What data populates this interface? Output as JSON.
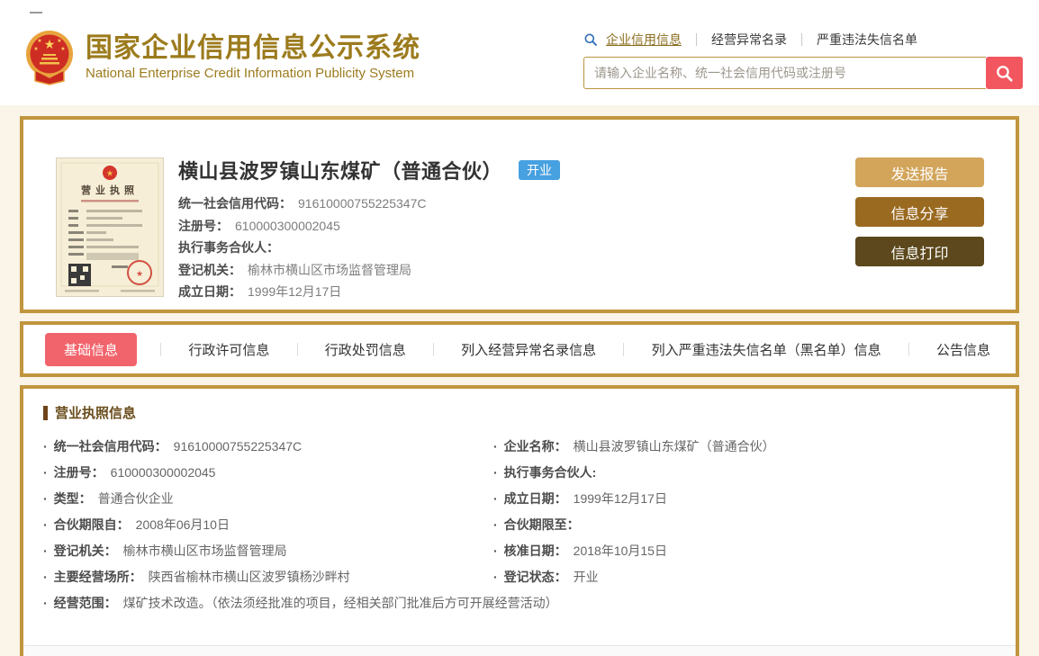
{
  "header": {
    "site_title": "国家企业信用信息公示系统",
    "site_subtitle": "National Enterprise Credit Information Publicity System",
    "nav": [
      {
        "label": "企业信用信息",
        "active": true
      },
      {
        "label": "经营异常名录",
        "active": false
      },
      {
        "label": "严重违法失信名单",
        "active": false
      }
    ],
    "search": {
      "placeholder": "请输入企业名称、统一社会信用代码或注册号"
    }
  },
  "company_card": {
    "name": "横山县波罗镇山东煤矿（普通合伙）",
    "status_badge": "开业",
    "license_thumb_title": "营业执照",
    "fields": [
      {
        "label": "统一社会信用代码：",
        "value": "91610000755225347C"
      },
      {
        "label": "注册号：",
        "value": "610000300002045"
      },
      {
        "label": "执行事务合伙人：",
        "value": ""
      },
      {
        "label": "登记机关：",
        "value": "榆林市横山区市场监督管理局"
      },
      {
        "label": "成立日期：",
        "value": "1999年12月17日"
      }
    ],
    "buttons": [
      {
        "label": "发送报告",
        "color": "#d2a55b"
      },
      {
        "label": "信息分享",
        "color": "#9a6a20"
      },
      {
        "label": "信息打印",
        "color": "#5c481c"
      }
    ]
  },
  "tabs": [
    {
      "label": "基础信息",
      "active": true
    },
    {
      "label": "行政许可信息",
      "active": false
    },
    {
      "label": "行政处罚信息",
      "active": false
    },
    {
      "label": "列入经营异常名录信息",
      "active": false
    },
    {
      "label": "列入严重违法失信名单（黑名单）信息",
      "active": false
    },
    {
      "label": "公告信息",
      "active": false
    }
  ],
  "license_section": {
    "title": "营业执照信息",
    "left": [
      {
        "label": "统一社会信用代码：",
        "value": "91610000755225347C"
      },
      {
        "label": "注册号：",
        "value": "610000300002045"
      },
      {
        "label": "类型：",
        "value": "普通合伙企业"
      },
      {
        "label": "合伙期限自：",
        "value": "2008年06月10日"
      },
      {
        "label": "登记机关：",
        "value": "榆林市横山区市场监督管理局"
      },
      {
        "label": "主要经营场所：",
        "value": "陕西省榆林市横山区波罗镇杨沙畔村"
      }
    ],
    "right": [
      {
        "label": "企业名称：",
        "value": "横山县波罗镇山东煤矿（普通合伙）"
      },
      {
        "label": "执行事务合伙人:",
        "value": ""
      },
      {
        "label": "成立日期：",
        "value": "1999年12月17日"
      },
      {
        "label": "合伙期限至：",
        "value": ""
      },
      {
        "label": "核准日期：",
        "value": "2018年10月15日"
      },
      {
        "label": "登记状态：",
        "value": "开业"
      }
    ],
    "scope": {
      "label": "经营范围：",
      "value": "煤矿技术改造。（依法须经批准的项目，经相关部门批准后方可开展经营活动）"
    }
  },
  "theme": {
    "gold_border": "#c1953e",
    "title_gold": "#9c7b1d",
    "page_cream": "#faf4e9",
    "active_tab_red": "#f2646c",
    "search_button_red": "#f2575f",
    "status_badge_blue": "#47a0e0"
  }
}
